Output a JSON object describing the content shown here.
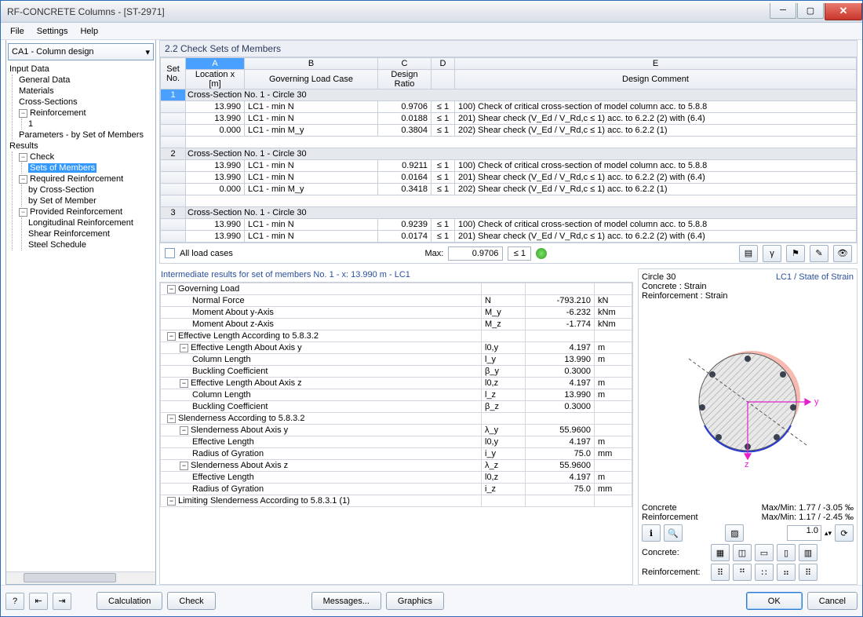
{
  "window": {
    "title": "RF-CONCRETE Columns - [ST-2971]"
  },
  "menu": [
    "File",
    "Settings",
    "Help"
  ],
  "combo": "CA1 - Column design",
  "tree": {
    "input": "Input Data",
    "general": "General Data",
    "materials": "Materials",
    "cross": "Cross-Sections",
    "reinf": "Reinforcement",
    "one": "1",
    "params": "Parameters - by Set of Members",
    "results": "Results",
    "check": "Check",
    "setsMembers": "Sets of Members",
    "reqReinf": "Required Reinforcement",
    "byCS": "by Cross-Section",
    "bySM": "by Set of Member",
    "provReinf": "Provided Reinforcement",
    "longR": "Longitudinal Reinforcement",
    "shearR": "Shear Reinforcement",
    "steelS": "Steel Schedule"
  },
  "panel": "2.2 Check Sets of Members",
  "cols": {
    "A": "A",
    "B": "B",
    "C": "C",
    "D": "D",
    "E": "E",
    "set": "Set\nNo.",
    "loc": "Location\nx [m]",
    "gov": "Governing\nLoad Case",
    "ratio": "Design\nRatio",
    "comment": "Design Comment"
  },
  "sections": [
    {
      "no": "1",
      "title": "Cross-Section No. 1 - Circle 30",
      "rows": [
        {
          "x": "13.990",
          "lc": "LC1 - min N",
          "r": "0.9706",
          "d": "≤ 1",
          "c": "100) Check of critical cross-section of model column acc. to 5.8.8"
        },
        {
          "x": "13.990",
          "lc": "LC1 - min N",
          "r": "0.0188",
          "d": "≤ 1",
          "c": "201) Shear check (V_Ed / V_Rd,c ≤ 1) acc. to 6.2.2 (2) with (6.4)"
        },
        {
          "x": "0.000",
          "lc": "LC1 - min M_y",
          "r": "0.3804",
          "d": "≤ 1",
          "c": "202) Shear check (V_Ed / V_Rd,c ≤ 1) acc. to 6.2.2 (1)"
        }
      ]
    },
    {
      "no": "2",
      "title": "Cross-Section No. 1 - Circle 30",
      "rows": [
        {
          "x": "13.990",
          "lc": "LC1 - min N",
          "r": "0.9211",
          "d": "≤ 1",
          "c": "100) Check of critical cross-section of model column acc. to 5.8.8"
        },
        {
          "x": "13.990",
          "lc": "LC1 - min N",
          "r": "0.0164",
          "d": "≤ 1",
          "c": "201) Shear check (V_Ed / V_Rd,c ≤ 1) acc. to 6.2.2 (2) with (6.4)"
        },
        {
          "x": "0.000",
          "lc": "LC1 - min M_y",
          "r": "0.3418",
          "d": "≤ 1",
          "c": "202) Shear check (V_Ed / V_Rd,c ≤ 1) acc. to 6.2.2 (1)"
        }
      ]
    },
    {
      "no": "3",
      "title": "Cross-Section No. 1 - Circle 30",
      "rows": [
        {
          "x": "13.990",
          "lc": "LC1 - min N",
          "r": "0.9239",
          "d": "≤ 1",
          "c": "100) Check of critical cross-section of model column acc. to 5.8.8"
        },
        {
          "x": "13.990",
          "lc": "LC1 - min N",
          "r": "0.0174",
          "d": "≤ 1",
          "c": "201) Shear check (V_Ed / V_Rd,c ≤ 1) acc. to 6.2.2 (2) with (6.4)"
        }
      ]
    }
  ],
  "summary": {
    "all": "All load cases",
    "max": "Max:",
    "maxval": "0.9706",
    "cmp": "≤ 1"
  },
  "details": {
    "title": "Intermediate results for set of members No. 1 - x: 13.990 m - LC1",
    "rows": [
      {
        "t": "h",
        "pad": 0,
        "label": "Governing Load"
      },
      {
        "t": "v",
        "pad": 2,
        "label": "Normal Force",
        "sym": "N",
        "val": "-793.210",
        "unit": "kN"
      },
      {
        "t": "v",
        "pad": 2,
        "label": "Moment About y-Axis",
        "sym": "M_y",
        "val": "-6.232",
        "unit": "kNm"
      },
      {
        "t": "v",
        "pad": 2,
        "label": "Moment About z-Axis",
        "sym": "M_z",
        "val": "-1.774",
        "unit": "kNm"
      },
      {
        "t": "h",
        "pad": 0,
        "label": "Effective Length According to 5.8.3.2"
      },
      {
        "t": "h",
        "pad": 1,
        "label": "Effective Length About Axis y",
        "sym": "l0,y",
        "val": "4.197",
        "unit": "m"
      },
      {
        "t": "v",
        "pad": 2,
        "label": "Column Length",
        "sym": "l_y",
        "val": "13.990",
        "unit": "m"
      },
      {
        "t": "v",
        "pad": 2,
        "label": "Buckling Coefficient",
        "sym": "β_y",
        "val": "0.3000",
        "unit": ""
      },
      {
        "t": "h",
        "pad": 1,
        "label": "Effective Length About Axis z",
        "sym": "l0,z",
        "val": "4.197",
        "unit": "m"
      },
      {
        "t": "v",
        "pad": 2,
        "label": "Column Length",
        "sym": "l_z",
        "val": "13.990",
        "unit": "m"
      },
      {
        "t": "v",
        "pad": 2,
        "label": "Buckling Coefficient",
        "sym": "β_z",
        "val": "0.3000",
        "unit": ""
      },
      {
        "t": "h",
        "pad": 0,
        "label": "Slenderness According to 5.8.3.2"
      },
      {
        "t": "h",
        "pad": 1,
        "label": "Slenderness About Axis y",
        "sym": "λ_y",
        "val": "55.9600",
        "unit": ""
      },
      {
        "t": "v",
        "pad": 2,
        "label": "Effective Length",
        "sym": "l0,y",
        "val": "4.197",
        "unit": "m"
      },
      {
        "t": "v",
        "pad": 2,
        "label": "Radius of Gyration",
        "sym": "i_y",
        "val": "75.0",
        "unit": "mm"
      },
      {
        "t": "h",
        "pad": 1,
        "label": "Slenderness About Axis z",
        "sym": "λ_z",
        "val": "55.9600",
        "unit": ""
      },
      {
        "t": "v",
        "pad": 2,
        "label": "Effective Length",
        "sym": "l0,z",
        "val": "4.197",
        "unit": "m"
      },
      {
        "t": "v",
        "pad": 2,
        "label": "Radius of Gyration",
        "sym": "i_z",
        "val": "75.0",
        "unit": "mm"
      },
      {
        "t": "h",
        "pad": 0,
        "label": "Limiting Slenderness According to 5.8.3.1 (1)"
      }
    ]
  },
  "preview": {
    "title": "Circle 30",
    "mode": "LC1 / State of Strain",
    "l1": "Concrete : Strain",
    "l2": "Reinforcement : Strain",
    "concrete": "Concrete",
    "reinf": "Reinforcement",
    "cmm": "Max/Min: 1.77 / -3.05 ‰",
    "rmm": "Max/Min: 1.17 / -2.45 ‰",
    "concreteLbl": "Concrete:",
    "reinfLbl": "Reinforcement:",
    "zoom": "1.0"
  },
  "footer": {
    "calc": "Calculation",
    "check": "Check",
    "msg": "Messages...",
    "gfx": "Graphics",
    "ok": "OK",
    "cancel": "Cancel"
  }
}
